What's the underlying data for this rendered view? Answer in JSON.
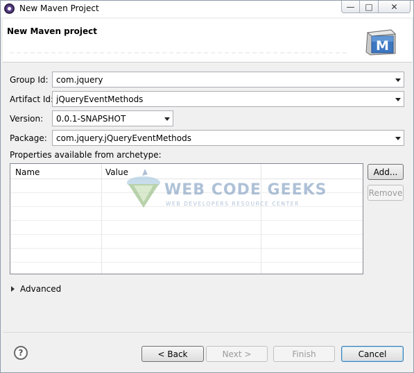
{
  "window": {
    "title": "New Maven Project",
    "minimize_glyph": "—",
    "maximize_glyph": "□",
    "close_glyph": "✕"
  },
  "banner": {
    "title": "New Maven project",
    "logo_letter": "M"
  },
  "form": {
    "group_id": {
      "label": "Group Id:",
      "value": "com.jquery"
    },
    "artifact_id": {
      "label": "Artifact Id:",
      "value": "jQueryEventMethods"
    },
    "version": {
      "label": "Version:",
      "value": "0.0.1-SNAPSHOT"
    },
    "package": {
      "label": "Package:",
      "value": "com.jquery.jQueryEventMethods"
    }
  },
  "properties": {
    "label": "Properties available from archetype:",
    "columns": [
      "Name",
      "Value"
    ],
    "add_button": "Add...",
    "remove_button": "Remove"
  },
  "advanced": {
    "label": "Advanced"
  },
  "footer": {
    "help_glyph": "?",
    "back": "< Back",
    "next": "Next >",
    "finish": "Finish",
    "cancel": "Cancel"
  },
  "watermark": {
    "name": "WEB CODE GEEKS",
    "tagline": "WEB DEVELOPERS RESOURCE CENTER"
  },
  "colors": {
    "accent_default_button": "#3c7fb1",
    "window_bg": "#f0f0f0",
    "watermark": "#6d8fb7"
  }
}
